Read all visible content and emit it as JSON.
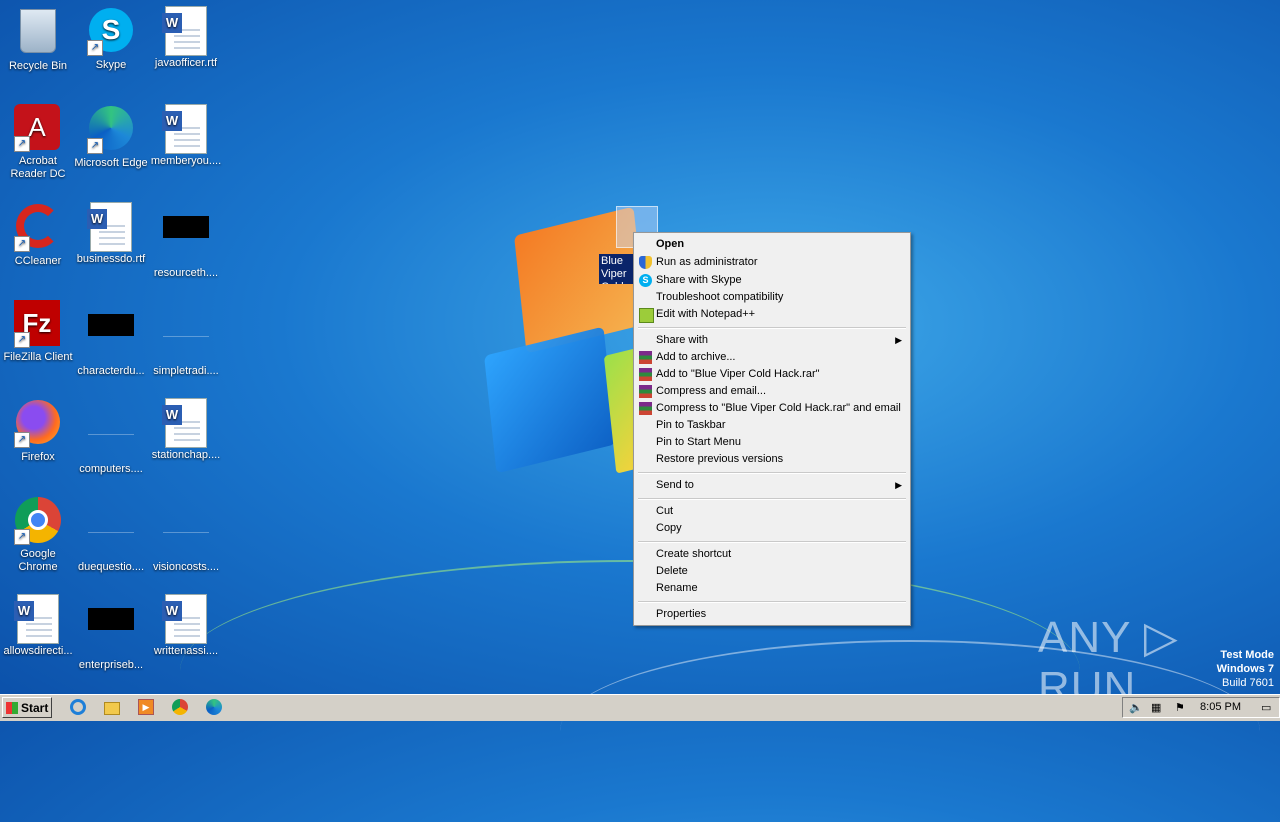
{
  "desktop": {
    "icons": [
      {
        "label": "Recycle Bin"
      },
      {
        "label": "Skype"
      },
      {
        "label": "javaofficer.rtf"
      },
      {
        "label": "Acrobat Reader DC"
      },
      {
        "label": "Microsoft Edge"
      },
      {
        "label": "memberyou...."
      },
      {
        "label": "CCleaner"
      },
      {
        "label": "businessdo.rtf"
      },
      {
        "label": "resourceth...."
      },
      {
        "label": "FileZilla Client"
      },
      {
        "label": "characterdu..."
      },
      {
        "label": "simpletradi...."
      },
      {
        "label": "Firefox"
      },
      {
        "label": "computers...."
      },
      {
        "label": "stationchap...."
      },
      {
        "label": "Google Chrome"
      },
      {
        "label": "duequestio...."
      },
      {
        "label": "visioncosts...."
      },
      {
        "label": "allowsdirecti..."
      },
      {
        "label": "enterpriseb..."
      },
      {
        "label": "writtenassi...."
      }
    ],
    "selected_item_label": "Blue Viper Cold Hack"
  },
  "context_menu": {
    "items": [
      {
        "label": "Open"
      },
      {
        "label": "Run as administrator"
      },
      {
        "label": "Share with Skype"
      },
      {
        "label": "Troubleshoot compatibility"
      },
      {
        "label": "Edit with Notepad++"
      },
      {
        "label": "Share with"
      },
      {
        "label": "Add to archive..."
      },
      {
        "label": "Add to \"Blue Viper Cold Hack.rar\""
      },
      {
        "label": "Compress and email..."
      },
      {
        "label": "Compress to \"Blue Viper Cold Hack.rar\" and email"
      },
      {
        "label": "Pin to Taskbar"
      },
      {
        "label": "Pin to Start Menu"
      },
      {
        "label": "Restore previous versions"
      },
      {
        "label": "Send to"
      },
      {
        "label": "Cut"
      },
      {
        "label": "Copy"
      },
      {
        "label": "Create shortcut"
      },
      {
        "label": "Delete"
      },
      {
        "label": "Rename"
      },
      {
        "label": "Properties"
      }
    ]
  },
  "watermark": {
    "text": "ANY ▷ RUN"
  },
  "system": {
    "line1": "Test Mode",
    "line2": "Windows 7",
    "line3": "Build 7601"
  },
  "taskbar": {
    "start_label": "Start",
    "clock": "8:05 PM"
  }
}
